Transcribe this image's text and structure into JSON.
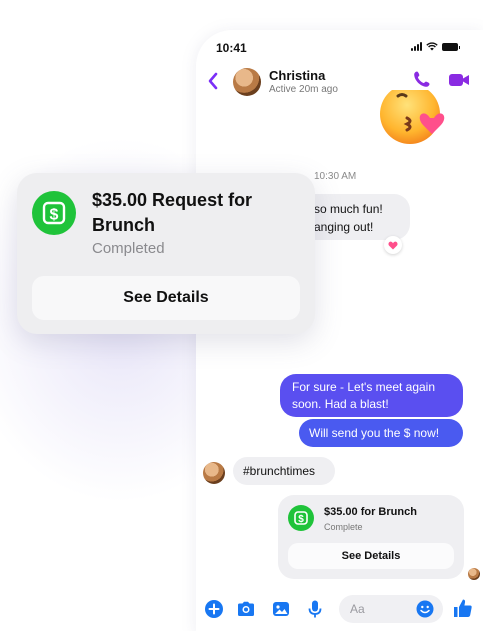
{
  "status_bar": {
    "time": "10:41"
  },
  "header": {
    "name": "Christina",
    "status": "Active 20m ago"
  },
  "conversation": {
    "timestamp": "10:30 AM",
    "incoming_text_line1": "so much fun!",
    "incoming_text_line2": "anging out!",
    "outgoing_1": "For sure - Let's meet again soon. Had a blast!",
    "outgoing_2": "Will send you the $ now!",
    "hashtag": "#brunchtimes",
    "payment_card": {
      "title": "$35.00 for Brunch",
      "status": "Complete",
      "button": "See Details"
    }
  },
  "composer": {
    "placeholder": "Aa"
  },
  "overlay_card": {
    "title": "$35.00 Request for Brunch",
    "status": "Completed",
    "button": "See Details"
  },
  "colors": {
    "accent": "#7b2ff7",
    "outgoing_bubble": "#5a4ff0",
    "cash_green": "#1fc33a",
    "composer_blue": "#1877f2"
  },
  "icons": [
    "back-icon",
    "phone-icon",
    "video-camera-icon",
    "heart-icon",
    "dollar-icon",
    "plus-icon",
    "camera-icon",
    "image-icon",
    "microphone-icon",
    "emoji-icon",
    "thumbs-up-icon"
  ]
}
